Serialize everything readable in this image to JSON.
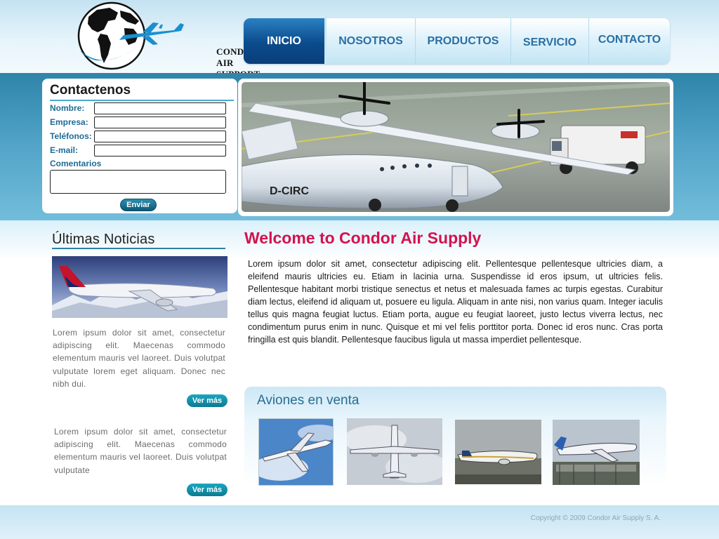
{
  "brand": {
    "line1": "CONDOR AIR",
    "line2": "SUPPORT, S.A"
  },
  "nav": {
    "items": [
      "INICIO",
      "NOSOTROS",
      "PRODUCTOS",
      "SERVICIO",
      "CONTACTO"
    ],
    "active": "INICIO"
  },
  "contact": {
    "title": "Contactenos",
    "fields": [
      "Nombre:",
      "Empresa:",
      "Teléfonos:",
      "E-mail:"
    ],
    "comments_label": "Comentarios",
    "send_label": "Enviar"
  },
  "hero": {
    "tail_code": "D-CIRC"
  },
  "news": {
    "title": "Últimas Noticias",
    "items": [
      {
        "text": "Lorem ipsum dolor sit amet, consectetur adipiscing elit. Maecenas commodo elementum mauris vel laoreet. Duis volutpat vulputate lorem eget aliquam. Donec nec nibh dui.",
        "more": "Ver más"
      },
      {
        "text": "Lorem ipsum dolor sit amet, consectetur adipiscing elit. Maecenas commodo elementum mauris vel laoreet. Duis volutpat vulputate",
        "more": "Ver más"
      }
    ]
  },
  "main": {
    "heading": "Welcome to Condor Air Supply",
    "body": "Lorem ipsum dolor sit amet, consectetur adipiscing elit. Pellentesque pellentesque ultricies diam, a eleifend mauris ultricies eu. Etiam in lacinia urna. Suspendisse id eros ipsum, ut ultricies felis. Pellentesque habitant morbi tristique senectus et netus et malesuada fames ac turpis egestas. Curabitur diam lectus, eleifend id aliquam ut, posuere eu ligula. Aliquam in ante nisi, non varius quam. Integer iaculis tellus quis magna feugiat luctus. Etiam porta, augue eu feugiat laoreet, justo lectus viverra lectus, nec condimentum purus enim in nunc. Quisque et mi vel felis porttitor porta. Donec id eros nunc. Cras porta fringilla est quis blandit. Pellentesque faucibus ligula ut massa imperdiet pellentesque."
  },
  "sale": {
    "title": "Aviones en venta"
  },
  "footer": {
    "copyright": "Copyright © 2009 Condor Air Supply S. A."
  },
  "colors": {
    "accent": "#d3124f",
    "nav_text": "#2a6fa3",
    "band": "#4fa2c6",
    "button": "#0c7b93"
  }
}
